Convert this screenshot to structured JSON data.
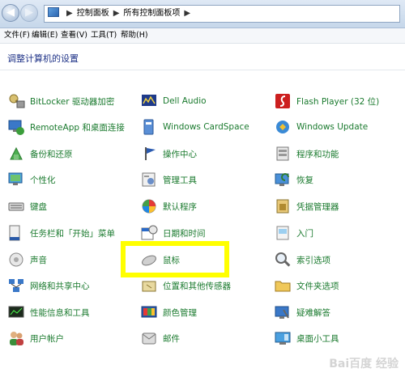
{
  "address_bar": {
    "crumbs": [
      "控制面板",
      "所有控制面板项"
    ]
  },
  "menu": [
    {
      "label": "文件(F)"
    },
    {
      "label": "编辑(E)"
    },
    {
      "label": "查看(V)"
    },
    {
      "label": "工具(T)"
    },
    {
      "label": "帮助(H)"
    }
  ],
  "header": {
    "title": "调整计算机的设置"
  },
  "items": [
    {
      "label": "BitLocker 驱动器加密",
      "icon": "bitlocker-icon"
    },
    {
      "label": "RemoteApp 和桌面连接",
      "icon": "remoteapp-icon"
    },
    {
      "label": "备份和还原",
      "icon": "backup-restore-icon"
    },
    {
      "label": "个性化",
      "icon": "personalization-icon"
    },
    {
      "label": "键盘",
      "icon": "keyboard-icon"
    },
    {
      "label": "任务栏和「开始」菜单",
      "icon": "taskbar-icon"
    },
    {
      "label": "声音",
      "icon": "sound-icon"
    },
    {
      "label": "网络和共享中心",
      "icon": "network-icon"
    },
    {
      "label": "性能信息和工具",
      "icon": "performance-icon"
    },
    {
      "label": "用户帐户",
      "icon": "user-accounts-icon"
    },
    {
      "label": "Dell Audio",
      "icon": "dell-audio-icon"
    },
    {
      "label": "Windows CardSpace",
      "icon": "cardspace-icon"
    },
    {
      "label": "操作中心",
      "icon": "action-center-icon"
    },
    {
      "label": "管理工具",
      "icon": "admin-tools-icon"
    },
    {
      "label": "默认程序",
      "icon": "default-programs-icon"
    },
    {
      "label": "日期和时间",
      "icon": "date-time-icon"
    },
    {
      "label": "鼠标",
      "icon": "mouse-icon"
    },
    {
      "label": "位置和其他传感器",
      "icon": "location-sensor-icon"
    },
    {
      "label": "颜色管理",
      "icon": "color-management-icon"
    },
    {
      "label": "邮件",
      "icon": "mail-icon"
    },
    {
      "label": "Flash Player (32 位)",
      "icon": "flash-icon"
    },
    {
      "label": "Windows Update",
      "icon": "windows-update-icon"
    },
    {
      "label": "程序和功能",
      "icon": "programs-features-icon"
    },
    {
      "label": "恢复",
      "icon": "recovery-icon"
    },
    {
      "label": "凭据管理器",
      "icon": "credential-icon"
    },
    {
      "label": "入门",
      "icon": "getting-started-icon"
    },
    {
      "label": "索引选项",
      "icon": "indexing-icon"
    },
    {
      "label": "文件夹选项",
      "icon": "folder-options-icon"
    },
    {
      "label": "疑难解答",
      "icon": "troubleshooting-icon"
    },
    {
      "label": "桌面小工具",
      "icon": "gadgets-icon"
    }
  ],
  "watermark": "Bai百度 经验",
  "colors": {
    "item_text": "#1a7a2e",
    "header_text": "#1e3287",
    "highlight": "#ffff00"
  }
}
